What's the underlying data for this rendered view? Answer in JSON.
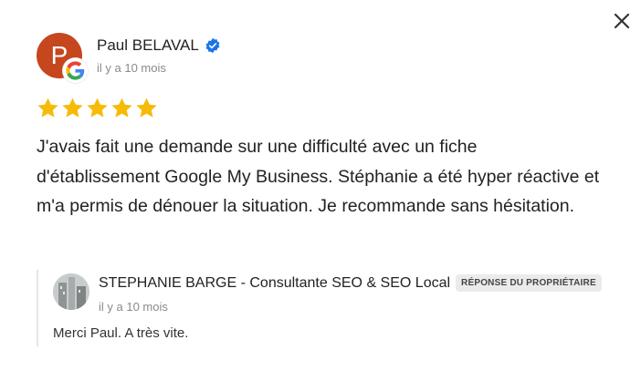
{
  "review": {
    "author_initial": "P",
    "author_name": "Paul BELAVAL",
    "time": "il y a 10 mois",
    "rating": 5,
    "text": "J'avais fait une demande sur une difficulté avec un fiche d'établissement Google My Business. Stéphanie a été hyper réactive et m'a permis de dénouer la situation. Je recommande sans hésitation."
  },
  "reply": {
    "author": "STEPHANIE BARGE - Consultante SEO & SEO Local",
    "badge": "RÉPONSE DU PROPRIÉTAIRE",
    "time": "il y a 10 mois",
    "text": "Merci Paul. A très vite."
  },
  "icons": {
    "close": "close-icon",
    "verified": "verified-icon",
    "google": "google-icon",
    "star": "star-icon"
  },
  "colors": {
    "avatar_bg": "#c6461d",
    "star": "#f6bb06",
    "verified": "#1a73e8",
    "badge_bg": "#ebebeb"
  }
}
